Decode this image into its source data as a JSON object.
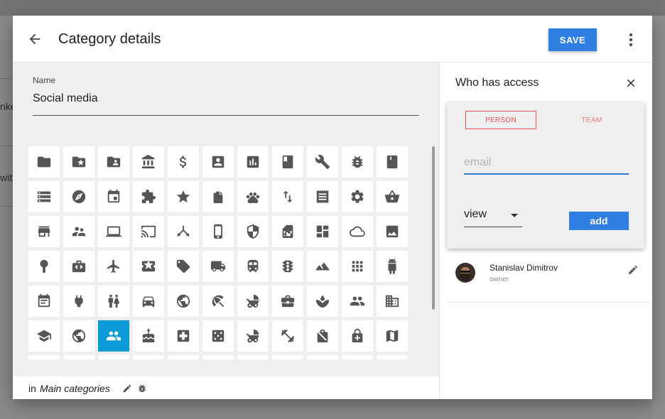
{
  "background": {
    "text_fragments": [
      "nke",
      "witt"
    ]
  },
  "dialog": {
    "title": "Category details",
    "save_label": "SAVE"
  },
  "name_field": {
    "label": "Name",
    "value": "Social media"
  },
  "icon_grid": {
    "selected_icon": "people-icon",
    "selected_color": "#0a9ad6",
    "icons": [
      "folder-icon",
      "folder-star-icon",
      "folder-account-icon",
      "bank-icon",
      "dollar-icon",
      "contact-card-icon",
      "bar-chart-icon",
      "book-icon",
      "wrench-icon",
      "bug-icon",
      "notebook-icon",
      "storage-icon",
      "compass-icon",
      "calendar-icon",
      "puzzle-icon",
      "star-icon",
      "stamp-icon",
      "paw-icon",
      "swap-vert-icon",
      "receipt-icon",
      "gear-icon",
      "basket-icon",
      "store-icon",
      "supervisor-icon",
      "laptop-icon",
      "cast-icon",
      "fork-icon",
      "phone-icon",
      "shield-icon",
      "sim-card-icon",
      "dashboard-icon",
      "cloud-icon",
      "image-icon",
      "pin-icon",
      "suitcase-icon",
      "airplane-icon",
      "ticket-icon",
      "tag-icon",
      "truck-icon",
      "train-icon",
      "traffic-icon",
      "landscape-icon",
      "apps-icon",
      "android-icon",
      "event-note-icon",
      "plug-icon",
      "wc-icon",
      "car-icon",
      "globe-lock-icon",
      "beach-icon",
      "stroller-icon",
      "briefcase-icon",
      "spa-icon",
      "people-alt-icon",
      "domain-icon",
      "school-icon",
      "public-icon",
      "people-icon",
      "cake-icon",
      "medical-icon",
      "dice-icon",
      "pram-icon",
      "fitness-icon",
      "lock-bag-icon",
      "lock-plus-icon",
      "map-icon",
      "blank-icon",
      "blank-icon",
      "blank-icon",
      "blank-icon",
      "blank-icon",
      "blank-icon",
      "blank-icon",
      "blank-icon",
      "blank-icon",
      "blank-icon",
      "blank-icon"
    ]
  },
  "footer": {
    "prefix": "in",
    "category": "Main categories"
  },
  "access": {
    "title": "Who has access",
    "tabs": [
      "PERSON",
      "TEAM"
    ],
    "email_placeholder": "email",
    "role_value": "view",
    "add_label": "add",
    "members": [
      {
        "name": "Stanislav Dimitrov",
        "role": "owner"
      }
    ]
  },
  "colors": {
    "accent": "#2f7fe3",
    "tab_active": "#e05454",
    "tab_inactive": "#e87a7a",
    "pane_bg": "#efefef"
  }
}
